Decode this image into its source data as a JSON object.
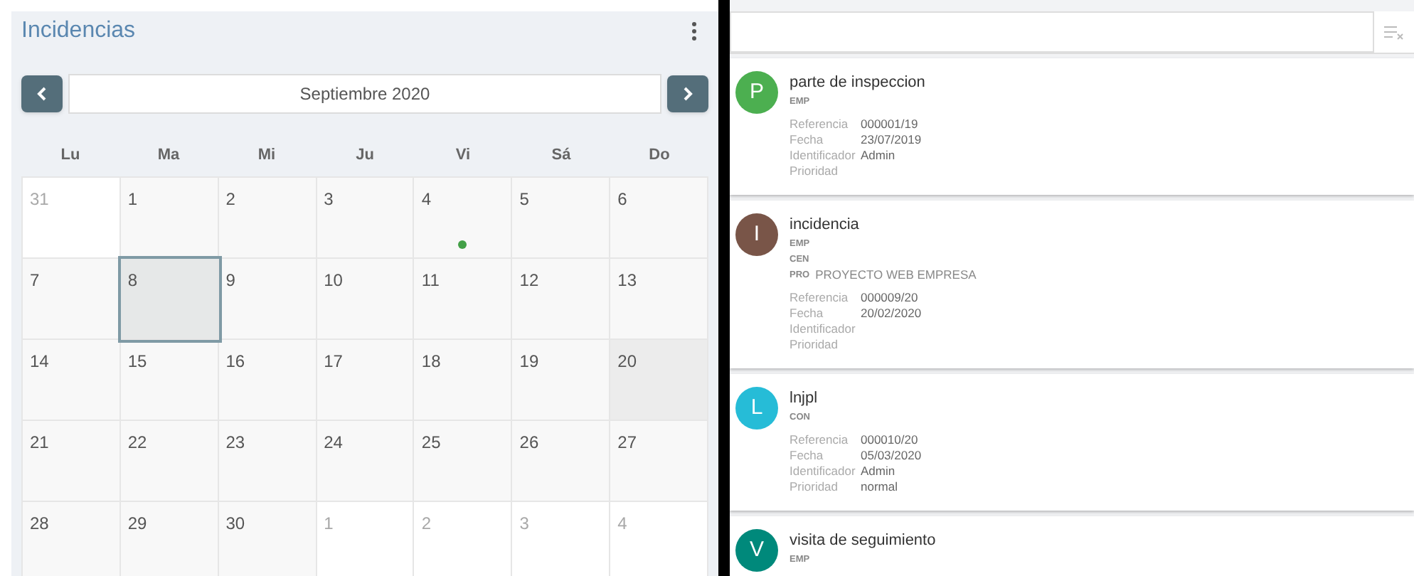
{
  "panel": {
    "title": "Incidencias"
  },
  "calendar": {
    "month": "Septiembre 2020",
    "weekdays": [
      "Lu",
      "Ma",
      "Mi",
      "Ju",
      "Vi",
      "Sá",
      "Do"
    ],
    "days": [
      {
        "label": "31",
        "other_month": true,
        "selected": false,
        "highlighted": false
      },
      {
        "label": "1",
        "other_month": false,
        "selected": false,
        "highlighted": false
      },
      {
        "label": "2",
        "other_month": false,
        "selected": false,
        "highlighted": false
      },
      {
        "label": "3",
        "other_month": false,
        "selected": false,
        "highlighted": false
      },
      {
        "label": "4",
        "other_month": false,
        "selected": false,
        "highlighted": false,
        "color": "#43a047"
      },
      {
        "label": "5",
        "other_month": false,
        "selected": false,
        "highlighted": false
      },
      {
        "label": "6",
        "other_month": false,
        "selected": false,
        "highlighted": false
      },
      {
        "label": "7",
        "other_month": false,
        "selected": false,
        "highlighted": false
      },
      {
        "label": "8",
        "other_month": false,
        "selected": true,
        "highlighted": false
      },
      {
        "label": "9",
        "other_month": false,
        "selected": false,
        "highlighted": false
      },
      {
        "label": "10",
        "other_month": false,
        "selected": false,
        "highlighted": false
      },
      {
        "label": "11",
        "other_month": false,
        "selected": false,
        "highlighted": false
      },
      {
        "label": "12",
        "other_month": false,
        "selected": false,
        "highlighted": false
      },
      {
        "label": "13",
        "other_month": false,
        "selected": false,
        "highlighted": false
      },
      {
        "label": "14",
        "other_month": false,
        "selected": false,
        "highlighted": false
      },
      {
        "label": "15",
        "other_month": false,
        "selected": false,
        "highlighted": false
      },
      {
        "label": "16",
        "other_month": false,
        "selected": false,
        "highlighted": false
      },
      {
        "label": "17",
        "other_month": false,
        "selected": false,
        "highlighted": false
      },
      {
        "label": "18",
        "other_month": false,
        "selected": false,
        "highlighted": false
      },
      {
        "label": "19",
        "other_month": false,
        "selected": false,
        "highlighted": false
      },
      {
        "label": "20",
        "other_month": false,
        "selected": false,
        "highlighted": true
      },
      {
        "label": "21",
        "other_month": false,
        "selected": false,
        "highlighted": false
      },
      {
        "label": "22",
        "other_month": false,
        "selected": false,
        "highlighted": false
      },
      {
        "label": "23",
        "other_month": false,
        "selected": false,
        "highlighted": false
      },
      {
        "label": "24",
        "other_month": false,
        "selected": false,
        "highlighted": false
      },
      {
        "label": "25",
        "other_month": false,
        "selected": false,
        "highlighted": false
      },
      {
        "label": "26",
        "other_month": false,
        "selected": false,
        "highlighted": false
      },
      {
        "label": "27",
        "other_month": false,
        "selected": false,
        "highlighted": false
      },
      {
        "label": "28",
        "other_month": false,
        "selected": false,
        "highlighted": false
      },
      {
        "label": "29",
        "other_month": false,
        "selected": false,
        "highlighted": false
      },
      {
        "label": "30",
        "other_month": false,
        "selected": false,
        "highlighted": false
      },
      {
        "label": "1",
        "other_month": true,
        "selected": false,
        "highlighted": false
      },
      {
        "label": "2",
        "other_month": true,
        "selected": false,
        "highlighted": false
      },
      {
        "label": "3",
        "other_month": true,
        "selected": false,
        "highlighted": false
      },
      {
        "label": "4",
        "other_month": true,
        "selected": false,
        "highlighted": false
      }
    ]
  },
  "items": [
    {
      "initial": "P",
      "color": "#4caf50",
      "title": "parte de inspeccion",
      "codes": [
        {
          "code": "EMP"
        }
      ],
      "fields": [
        {
          "label": "Referencia",
          "value": "000001/19"
        },
        {
          "label": "Fecha",
          "value": "23/07/2019"
        },
        {
          "label": "Identificador",
          "value": "Admin"
        },
        {
          "label": "Prioridad"
        }
      ]
    },
    {
      "initial": "I",
      "color": "#795548",
      "title": "incidencia",
      "codes": [
        {
          "code": "EMP"
        },
        {
          "code": "CEN"
        },
        {
          "code": "PRO",
          "value": "PROYECTO WEB EMPRESA"
        }
      ],
      "fields": [
        {
          "label": "Referencia",
          "value": "000009/20"
        },
        {
          "label": "Fecha",
          "value": "20/02/2020"
        },
        {
          "label": "Identificador"
        },
        {
          "label": "Prioridad"
        }
      ]
    },
    {
      "initial": "L",
      "color": "#26bcd7",
      "title": "lnjpl",
      "codes": [
        {
          "code": "CON"
        }
      ],
      "fields": [
        {
          "label": "Referencia",
          "value": "000010/20"
        },
        {
          "label": "Fecha",
          "value": "05/03/2020"
        },
        {
          "label": "Identificador",
          "value": "Admin"
        },
        {
          "label": "Prioridad",
          "value": "normal"
        }
      ]
    },
    {
      "initial": "V",
      "color": "#00897b",
      "title": "visita de seguimiento",
      "codes": [
        {
          "code": "EMP"
        }
      ]
    }
  ]
}
